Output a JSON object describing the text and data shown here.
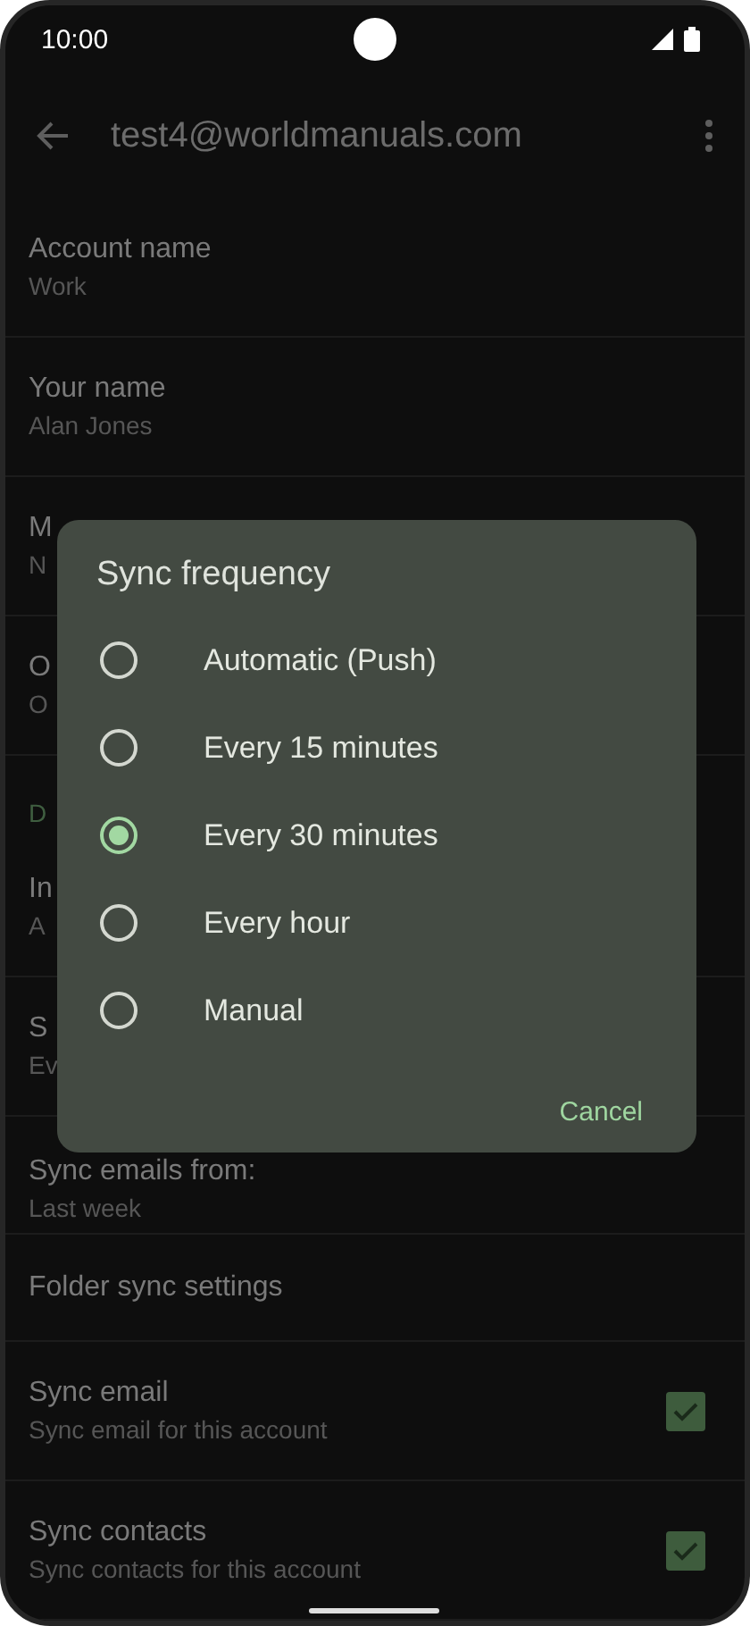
{
  "status_bar": {
    "time": "10:00"
  },
  "app_bar": {
    "title": "test4@worldmanuals.com"
  },
  "settings": [
    {
      "kind": "item",
      "title": "Account name",
      "summary": "Work"
    },
    {
      "kind": "item",
      "title": "Your name",
      "summary": "Alan Jones"
    },
    {
      "kind": "item",
      "title": "M",
      "summary": "N"
    },
    {
      "kind": "item",
      "title": "O",
      "summary": "O"
    },
    {
      "kind": "header",
      "title": "D"
    },
    {
      "kind": "item",
      "title": "In",
      "summary": "A"
    },
    {
      "kind": "item",
      "title": "S",
      "summary": "Ev"
    },
    {
      "kind": "item",
      "title": "Sync emails from:",
      "summary": "Last week"
    },
    {
      "kind": "single",
      "title": "Folder sync settings"
    },
    {
      "kind": "check",
      "title": "Sync email",
      "summary": "Sync email for this account",
      "checked": true
    },
    {
      "kind": "check",
      "title": "Sync contacts",
      "summary": "Sync contacts for this account",
      "checked": true
    }
  ],
  "dialog": {
    "title": "Sync frequency",
    "options": [
      {
        "label": "Automatic (Push)",
        "selected": false
      },
      {
        "label": "Every 15 minutes",
        "selected": false
      },
      {
        "label": "Every 30 minutes",
        "selected": true
      },
      {
        "label": "Every hour",
        "selected": false
      },
      {
        "label": "Manual",
        "selected": false
      }
    ],
    "buttons": [
      "Cancel"
    ]
  }
}
